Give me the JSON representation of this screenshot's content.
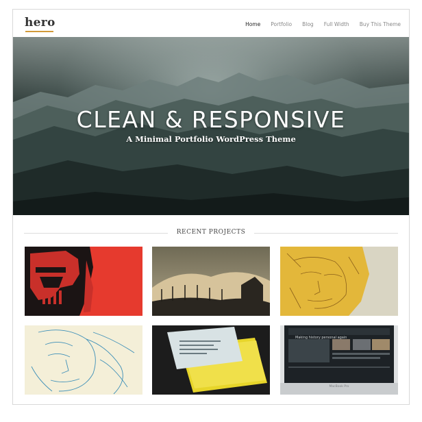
{
  "site": {
    "logo": "hero"
  },
  "nav": {
    "items": [
      {
        "label": "Home",
        "active": true
      },
      {
        "label": "Portfolio",
        "active": false
      },
      {
        "label": "Blog",
        "active": false
      },
      {
        "label": "Full Width",
        "active": false
      },
      {
        "label": "Buy This Theme",
        "active": false
      }
    ]
  },
  "hero": {
    "title": "CLEAN & RESPONSIVE",
    "subtitle": "A Minimal Portfolio WordPress Theme"
  },
  "section": {
    "title": "RECENT PROJECTS"
  },
  "projects": [
    {
      "name": "robot-helmet-illustration"
    },
    {
      "name": "wind-turbines-landscape"
    },
    {
      "name": "sketched-face-yellow"
    },
    {
      "name": "line-art-face-blue"
    },
    {
      "name": "yellow-business-cards"
    },
    {
      "name": "website-on-laptop"
    }
  ],
  "laptop_screen": {
    "headline": "Making history personal again",
    "brand": "MacBook Pro"
  },
  "colors": {
    "logo_underline": "#d29a3a",
    "nav_active": "#222222",
    "nav_inactive": "#888888"
  }
}
